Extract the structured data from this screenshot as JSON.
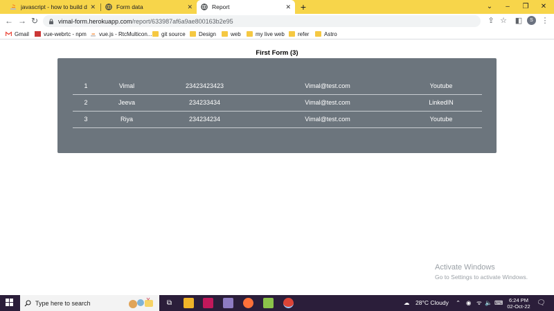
{
  "browser": {
    "tabs": [
      {
        "label": "javascript - how to build dynam"
      },
      {
        "label": "Form data"
      },
      {
        "label": "Report"
      }
    ],
    "url": {
      "host": "vimal-form.herokuapp.com",
      "path": "/report/633987af6a9ae800163b2e95"
    },
    "profile_initial": "S",
    "bookmarks": [
      {
        "label": "Gmail"
      },
      {
        "label": "vue-webrtc - npm"
      },
      {
        "label": "vue.js - RtcMulticon..."
      },
      {
        "label": "git source"
      },
      {
        "label": "Design"
      },
      {
        "label": "web"
      },
      {
        "label": "my live web"
      },
      {
        "label": "refer"
      },
      {
        "label": "Astro"
      }
    ],
    "colors": {
      "tabstrip": "#f7d54a",
      "card": "#6c757d",
      "taskbar": "#2b1e3a"
    }
  },
  "page": {
    "title": "First Form (3)",
    "rows": [
      {
        "index": "1",
        "name": "Vimal",
        "phone": "23423423423",
        "email": "Vimal@test.com",
        "source": "Youtube"
      },
      {
        "index": "2",
        "name": "Jeeva",
        "phone": "234233434",
        "email": "Vimal@test.com",
        "source": "LinkedIN"
      },
      {
        "index": "3",
        "name": "Riya",
        "phone": "234234234",
        "email": "Vimal@test.com",
        "source": "Youtube"
      }
    ]
  },
  "watermark": {
    "line1": "Activate Windows",
    "line2": "Go to Settings to activate Windows."
  },
  "taskbar": {
    "search_placeholder": "Type here to search",
    "weather": "28°C  Cloudy",
    "time": "6:24 PM",
    "date": "02-Oct-22"
  }
}
